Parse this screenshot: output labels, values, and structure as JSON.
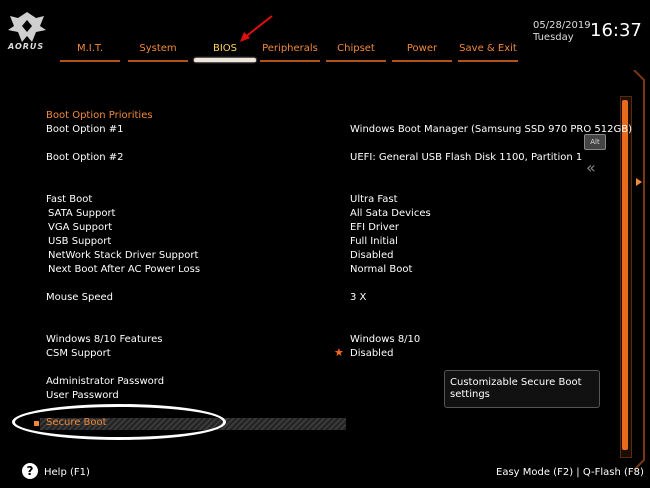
{
  "header": {
    "logo_text": "AORUS",
    "date": "05/28/2019",
    "day": "Tuesday",
    "time": "16:37",
    "tabs": [
      {
        "label": "M.I.T."
      },
      {
        "label": "System"
      },
      {
        "label": "BIOS"
      },
      {
        "label": "Peripherals"
      },
      {
        "label": "Chipset"
      },
      {
        "label": "Power"
      },
      {
        "label": "Save & Exit"
      }
    ]
  },
  "side": {
    "alt_label": "Alt",
    "chevron": "«"
  },
  "main": {
    "section_title": "Boot Option Priorities",
    "rows": [
      {
        "label": "Boot Option #1",
        "value": "Windows Boot Manager (Samsung SSD 970 PRO 512GB)"
      },
      {
        "label": "Boot Option #2",
        "value": "UEFI: General USB Flash Disk 1100, Partition 1"
      },
      {
        "label": "Fast Boot",
        "value": "Ultra Fast"
      },
      {
        "label": "SATA Support",
        "value": "All Sata Devices"
      },
      {
        "label": "VGA Support",
        "value": "EFI Driver"
      },
      {
        "label": "USB Support",
        "value": "Full Initial"
      },
      {
        "label": "NetWork Stack Driver Support",
        "value": "Disabled"
      },
      {
        "label": "Next Boot After AC Power Loss",
        "value": "Normal Boot"
      },
      {
        "label": "Mouse Speed",
        "value": "3 X"
      },
      {
        "label": "Windows 8/10 Features",
        "value": "Windows 8/10"
      },
      {
        "label": "CSM Support",
        "value": "Disabled"
      },
      {
        "label": "Administrator Password",
        "value": ""
      },
      {
        "label": "User Password",
        "value": ""
      }
    ],
    "selected_item": "Secure Boot",
    "help_text": "Customizable Secure Boot settings"
  },
  "footer": {
    "help_icon_glyph": "?",
    "help": "Help (F1)",
    "right": "Easy Mode (F2)  |  Q-Flash (F8)"
  },
  "colors": {
    "accent": "#f08a3a",
    "active_tab": "#ffd25a",
    "background": "#000000"
  },
  "icons": {
    "logo": "aorus-eagle-icon",
    "arrow": "red-arrow-annotation-icon",
    "help": "question-circle-icon",
    "star": "star-icon",
    "chevron": "double-chevron-left-icon"
  }
}
